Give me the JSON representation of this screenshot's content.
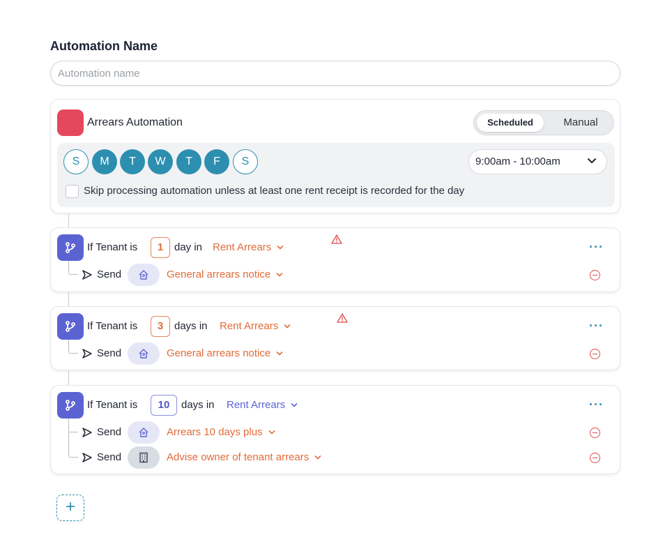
{
  "form": {
    "title": "Automation Name",
    "name_placeholder": "Automation name"
  },
  "automation": {
    "title": "Arrears Automation",
    "color": "#e5485c",
    "mode_options": [
      "Scheduled",
      "Manual"
    ],
    "mode_selected": "Scheduled",
    "days": [
      {
        "label": "S",
        "on": false
      },
      {
        "label": "M",
        "on": true
      },
      {
        "label": "T",
        "on": true
      },
      {
        "label": "W",
        "on": true
      },
      {
        "label": "T",
        "on": true
      },
      {
        "label": "F",
        "on": true
      },
      {
        "label": "S",
        "on": false
      }
    ],
    "time_window": "9:00am - 10:00am",
    "skip_label": "Skip processing automation unless at least one rent receipt is recorded for the day",
    "skip_checked": false
  },
  "rules": [
    {
      "if_label": "If Tenant is",
      "days": "1",
      "days_unit": "day in",
      "status": "Rent Arrears",
      "has_warning": true,
      "actions": [
        {
          "verb": "Send",
          "recipient_icon": "tenant-home-icon",
          "template": "General arrears notice"
        }
      ]
    },
    {
      "if_label": "If Tenant is",
      "days": "3",
      "days_unit": "days in",
      "status": "Rent Arrears",
      "has_warning": true,
      "actions": [
        {
          "verb": "Send",
          "recipient_icon": "tenant-home-icon",
          "template": "General arrears notice"
        }
      ]
    },
    {
      "if_label": "If Tenant is",
      "days": "10",
      "days_unit": "days in",
      "status": "Rent Arrears",
      "has_warning": false,
      "actions": [
        {
          "verb": "Send",
          "recipient_icon": "tenant-home-icon",
          "template": "Arrears 10 days plus"
        },
        {
          "verb": "Send",
          "recipient_icon": "owner-building-icon",
          "template": "Advise owner of tenant arrears"
        }
      ]
    }
  ],
  "add_button": "+",
  "colors": {
    "accent": "#2d8fb0",
    "branch": "#5b63d3",
    "warning_text": "#e16b3a",
    "danger": "#e04a4a"
  }
}
